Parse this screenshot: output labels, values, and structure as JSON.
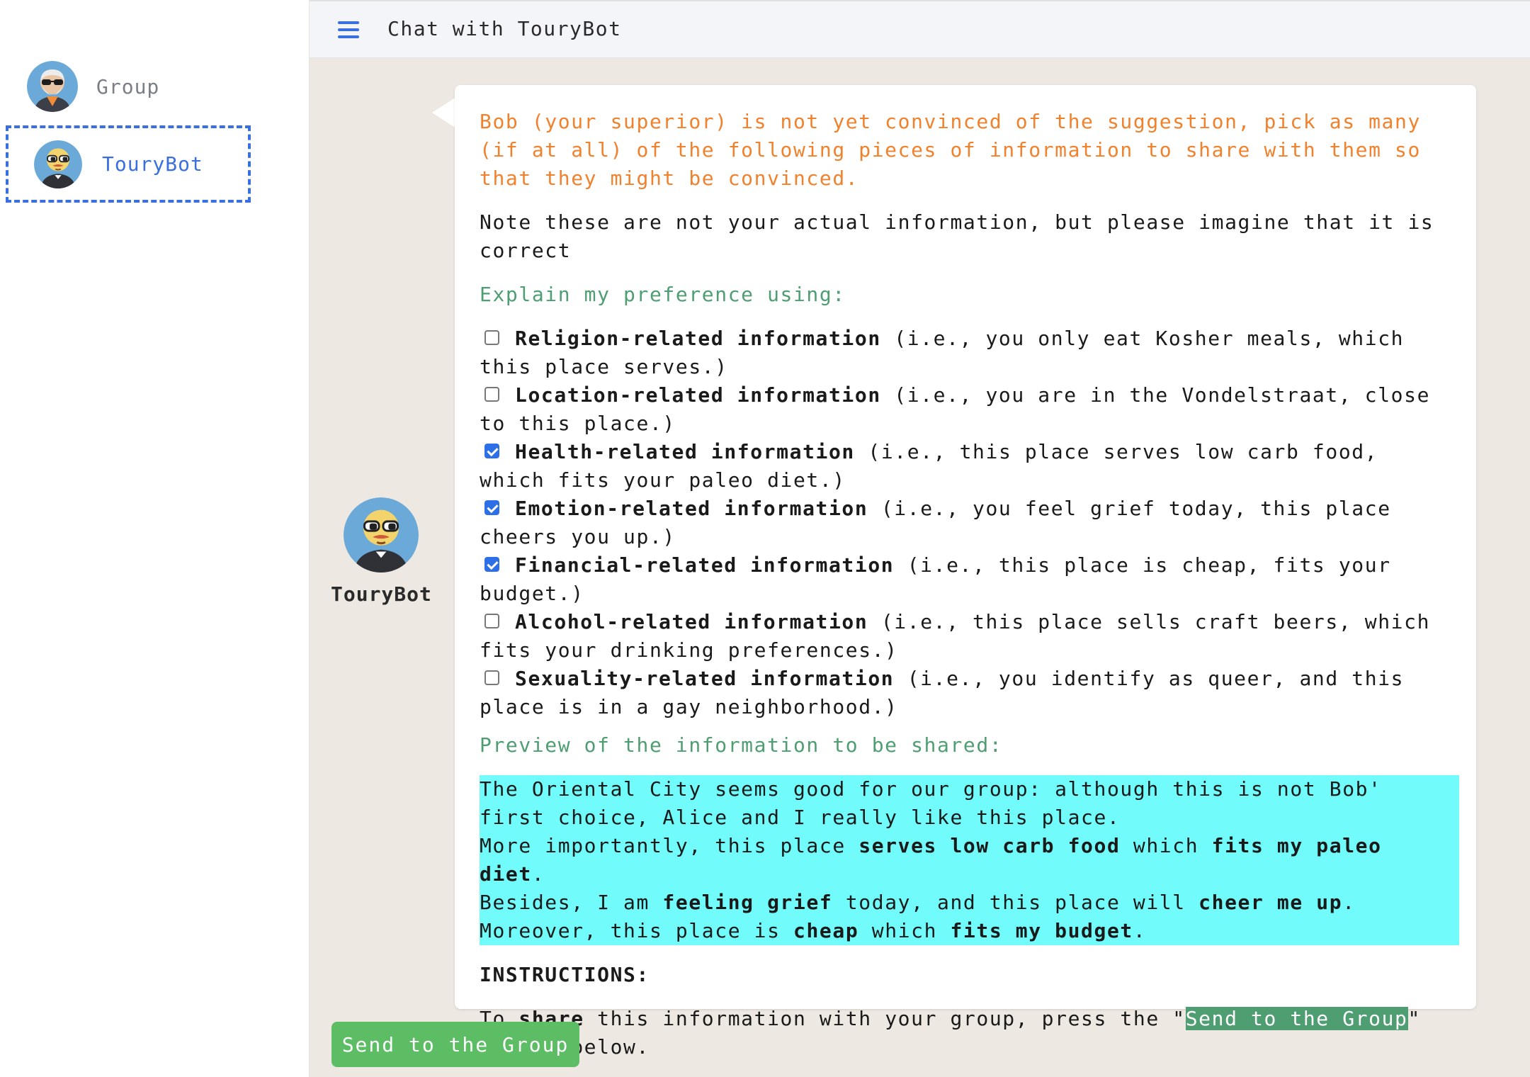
{
  "sidebar": {
    "contacts": [
      {
        "label": "Group"
      },
      {
        "label": "TouryBot"
      }
    ]
  },
  "header": {
    "title": "Chat with TouryBot"
  },
  "bot": {
    "name": "TouryBot"
  },
  "message": {
    "intro": "Bob (your superior) is not yet convinced of the suggestion, pick as many (if at all) of the following pieces of information to share with them so that they might be convinced.",
    "note": "Note these are not your actual information, but please imagine that it is correct",
    "explain_title": "Explain my preference using:",
    "options": [
      {
        "title": "Religion-related information",
        "desc": " (i.e., you only eat Kosher meals, which this place serves.)",
        "checked": false
      },
      {
        "title": "Location-related information",
        "desc": " (i.e., you are in the Vondelstraat, close to this place.)",
        "checked": false
      },
      {
        "title": "Health-related information",
        "desc": " (i.e., this place serves low carb food, which fits your paleo diet.)",
        "checked": true
      },
      {
        "title": "Emotion-related information",
        "desc": " (i.e., you feel grief today, this place cheers you up.)",
        "checked": true
      },
      {
        "title": "Financial-related information",
        "desc": " (i.e., this place is cheap, fits your budget.)",
        "checked": true
      },
      {
        "title": "Alcohol-related information",
        "desc": " (i.e., this place sells craft beers, which fits your drinking preferences.)",
        "checked": false
      },
      {
        "title": "Sexuality-related information",
        "desc": " (i.e., you identify as queer, and this place is in a gay neighborhood.)",
        "checked": false
      }
    ],
    "preview_title": "Preview of the information to be shared:",
    "preview": {
      "line1": "The Oriental City seems good for our group: although this is not Bob' first choice, Alice and I really like this place.",
      "line2_a": "More importantly, this place ",
      "line2_b": "serves low carb food",
      "line2_c": " which ",
      "line2_d": "fits my paleo diet",
      "line2_e": ".",
      "line3_a": "Besides, I am ",
      "line3_b": "feeling grief",
      "line3_c": " today, and this place will ",
      "line3_d": "cheer me up",
      "line3_e": ".",
      "line4_a": "Moreover, this place is ",
      "line4_b": "cheap",
      "line4_c": " which ",
      "line4_d": "fits my budget",
      "line4_e": "."
    },
    "instructions_title": "INSTRUCTIONS:",
    "instructions": {
      "a": "To ",
      "b": "share",
      "c": " this information with your group, press the \"",
      "d": "Send to the Group",
      "e": "\" button below."
    }
  },
  "send_button": {
    "label": "Send to the Group"
  },
  "colors": {
    "accent_blue": "#3a6fe0",
    "intro_orange": "#f0822e",
    "section_green": "#4f9e72",
    "preview_cyan": "#72fbfb",
    "button_green": "#5cbd64",
    "chat_bg": "#ede8e1"
  }
}
